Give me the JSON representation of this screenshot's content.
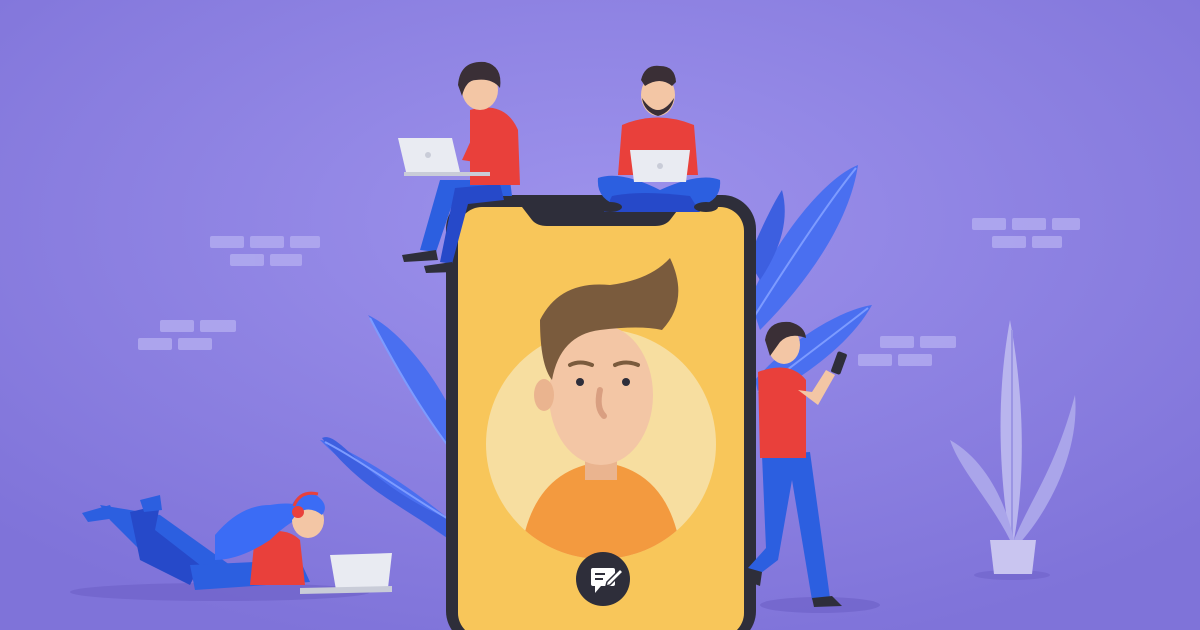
{
  "scene": {
    "description_tag": "",
    "colors": {
      "background": "#8b7fe0",
      "background_light": "#9a8fe8",
      "brick": "#b2abf0",
      "leaf": "#4a6ff0",
      "leaf_light": "#6a8cff",
      "phone_body": "#2e2e3a",
      "phone_screen": "#f8c65a",
      "avatar_circle": "#f7dea0",
      "avatar_shirt": "#f39a3f",
      "avatar_skin": "#f3c6a5",
      "avatar_hair": "#7a5b3d",
      "shirt_red": "#e9403b",
      "pants_blue": "#2c5fe0",
      "hair_dark": "#3a2f36",
      "hair_blue": "#3b6cf5",
      "laptop": "#e9ebf2",
      "plant": "#b9b5ee",
      "pot": "#c9c5f0",
      "message_button_bg": "#2e2e3a",
      "message_icon": "#ffffff"
    },
    "icons": {
      "message": "message-edit-icon"
    }
  }
}
